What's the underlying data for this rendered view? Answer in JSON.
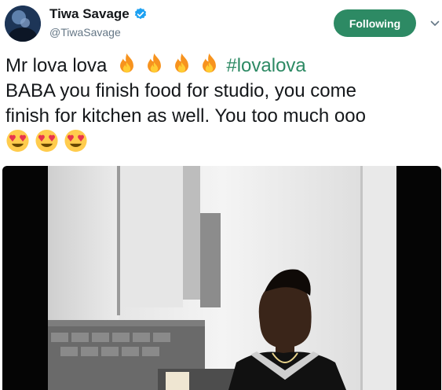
{
  "user": {
    "display_name": "Tiwa Savage",
    "handle": "@TiwaSavage",
    "verified_icon": "verified-badge-icon",
    "avatar_icon": "avatar"
  },
  "actions": {
    "follow_label": "Following",
    "menu_icon": "chevron-down-icon"
  },
  "tweet": {
    "line1_text": "Mr lova lova",
    "line1_emoji": [
      "fire-emoji",
      "fire-emoji",
      "fire-emoji",
      "fire-emoji"
    ],
    "hashtag": "#lovalova",
    "line2_text": "BABA you finish food for studio, you come",
    "line3_text": "finish for kitchen as well. You too much ooo",
    "line4_emoji": [
      "heart-eyes-emoji",
      "heart-eyes-emoji",
      "heart-eyes-emoji"
    ]
  },
  "media": {
    "type": "video",
    "scene": "man-in-kitchen"
  },
  "colors": {
    "accent": "#2d8a64",
    "text": "#14171a",
    "muted": "#657786",
    "verified": "#1da1f2"
  }
}
